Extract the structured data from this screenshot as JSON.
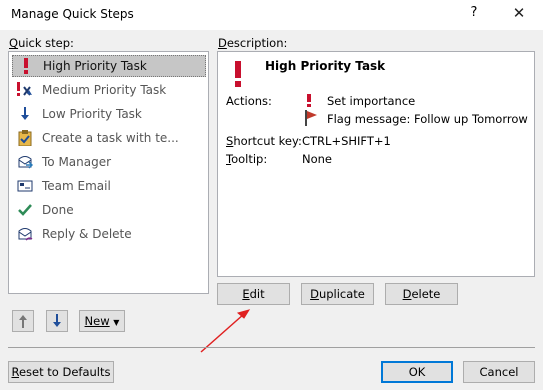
{
  "window": {
    "title": "Manage Quick Steps",
    "help_label": "?",
    "close_label": "✕"
  },
  "quick_step_label": "Quick step:",
  "description_label": "Description:",
  "quick_steps": [
    {
      "label": "High Priority Task",
      "icon": "exclamation-icon",
      "selected": true
    },
    {
      "label": "Medium Priority Task",
      "icon": "medium-priority-icon",
      "selected": false
    },
    {
      "label": "Low Priority Task",
      "icon": "down-arrow-icon",
      "selected": false
    },
    {
      "label": "Create a task with te...",
      "icon": "clipboard-icon",
      "selected": false
    },
    {
      "label": "To Manager",
      "icon": "forward-mail-icon",
      "selected": false
    },
    {
      "label": "Team Email",
      "icon": "email-icon",
      "selected": false
    },
    {
      "label": "Done",
      "icon": "checkmark-icon",
      "selected": false
    },
    {
      "label": "Reply & Delete",
      "icon": "reply-delete-icon",
      "selected": false
    }
  ],
  "description": {
    "title": "High Priority Task",
    "actions_label": "Actions:",
    "actions": [
      {
        "text": "Set importance",
        "icon": "exclamation-icon"
      },
      {
        "text": "Flag message: Follow up Tomorrow",
        "icon": "flag-icon"
      }
    ],
    "shortcut_label": "Shortcut key:",
    "shortcut_value": "CTRL+SHIFT+1",
    "tooltip_label": "Tooltip:",
    "tooltip_value": "None"
  },
  "buttons": {
    "edit": "Edit",
    "duplicate": "Duplicate",
    "delete": "Delete",
    "new": "New",
    "reset": "Reset to Defaults",
    "ok": "OK",
    "cancel": "Cancel"
  },
  "colors": {
    "importance_red": "#c8102e",
    "flag_red": "#c0392b",
    "arrow_blue": "#1f4e9a",
    "check_teal": "#2e8b57",
    "annotation_red": "#e02020"
  }
}
